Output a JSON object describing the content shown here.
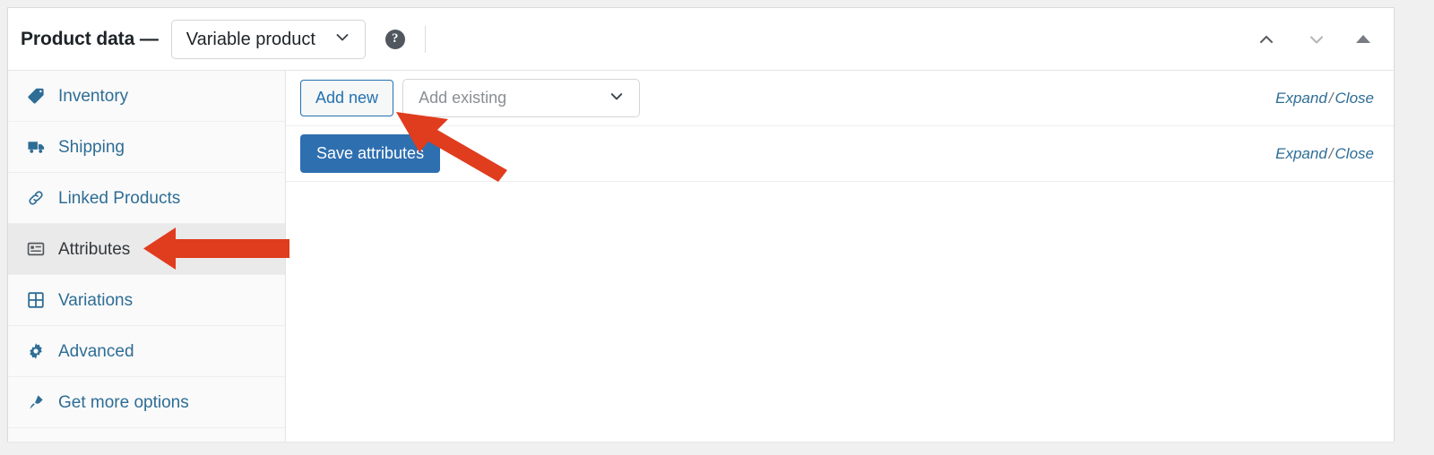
{
  "header": {
    "title": "Product data —",
    "product_type": "Variable product",
    "product_type_options": [
      "Variable product"
    ],
    "help_icon": "help-circle-icon",
    "move_up_icon": "chevron-up-icon",
    "move_down_icon": "chevron-down-icon",
    "toggle_icon": "triangle-up-icon"
  },
  "sidebar": {
    "items": [
      {
        "label": "Inventory",
        "icon": "tag-icon",
        "active": false
      },
      {
        "label": "Shipping",
        "icon": "truck-icon",
        "active": false
      },
      {
        "label": "Linked Products",
        "icon": "link-icon",
        "active": false
      },
      {
        "label": "Attributes",
        "icon": "list-view-icon",
        "active": true
      },
      {
        "label": "Variations",
        "icon": "grid-icon",
        "active": false
      },
      {
        "label": "Advanced",
        "icon": "gear-icon",
        "active": false
      },
      {
        "label": "Get more options",
        "icon": "plug-icon",
        "active": false
      }
    ]
  },
  "content": {
    "add_new_label": "Add new",
    "add_existing_placeholder": "Add existing",
    "add_existing_value": "",
    "add_existing_options": [
      "Add existing"
    ],
    "save_attributes_label": "Save attributes",
    "expand_label": "Expand",
    "separator": "/",
    "close_label": "Close"
  },
  "annotations": {
    "arrow_color": "#E03C1E",
    "arrows": [
      {
        "name": "arrow-to-attributes-tab",
        "points_to": "Attributes"
      },
      {
        "name": "arrow-to-add-new-button",
        "points_to": "Add new"
      }
    ]
  },
  "colors": {
    "page_background": "#f0f0f1",
    "panel_background": "#ffffff",
    "sidebar_background": "#fafafa",
    "active_tab_background": "#eaeaea",
    "link_blue": "#2e6d95",
    "primary_button": "#2e6fb0"
  }
}
